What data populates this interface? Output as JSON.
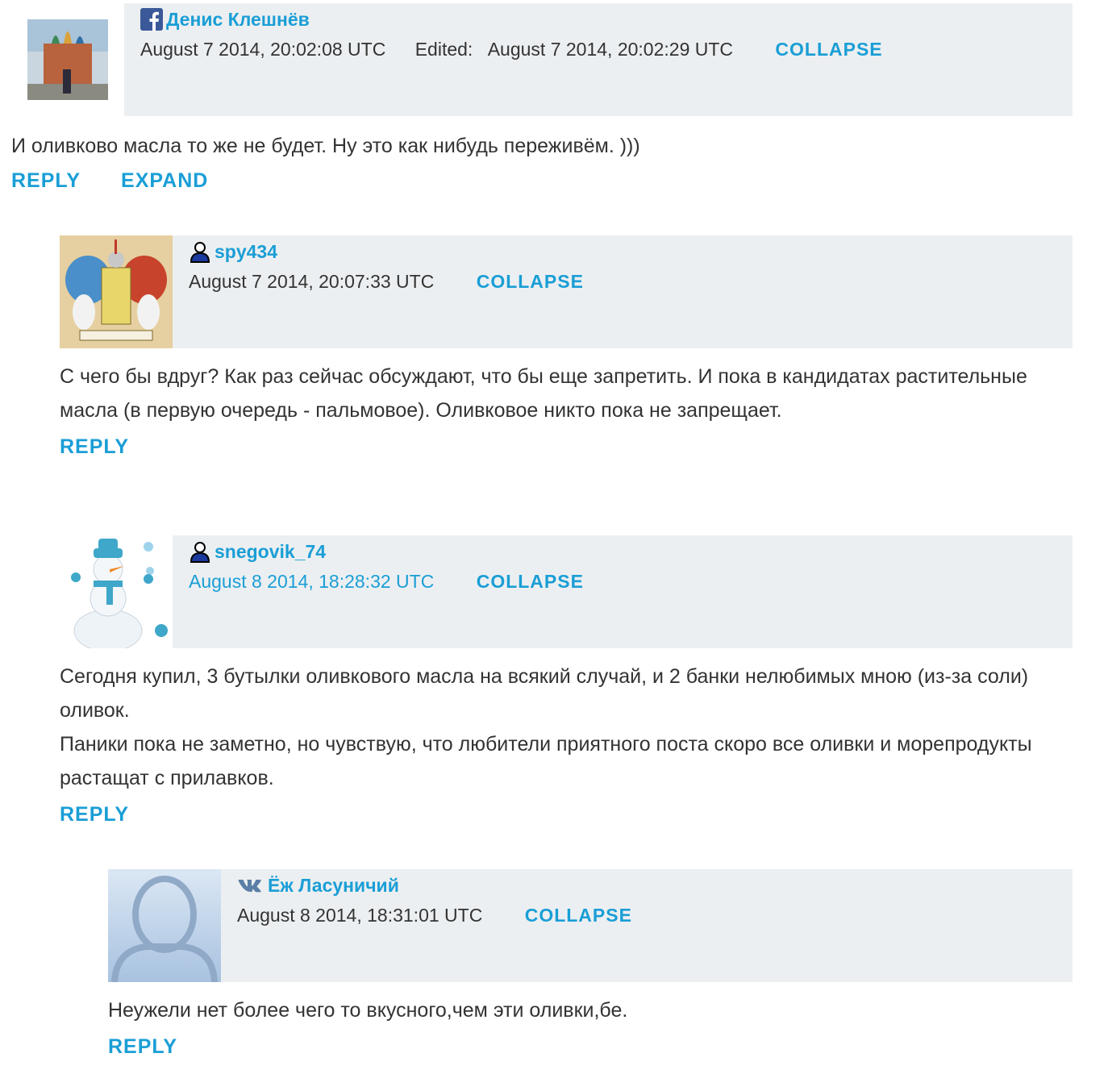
{
  "comments": [
    {
      "author": "Денис Клешнёв",
      "network_icon": "facebook-icon",
      "date": "August 7 2014, 20:02:08 UTC",
      "edited_label": "Edited:",
      "edited_date": "August 7 2014, 20:02:29 UTC",
      "collapse_label": "COLLAPSE",
      "text": "И оливково масла то же не будет. Ну это как нибудь переживём. )))",
      "reply_label": "REPLY",
      "expand_label": "EXPAND"
    },
    {
      "author": "spy434",
      "network_icon": "user-icon",
      "date": "August 7 2014, 20:07:33 UTC",
      "collapse_label": "COLLAPSE",
      "text": "С чего бы вдруг? Как раз сейчас обсуждают, что бы еще запретить. И пока в кандидатах растительные масла (в первую очередь - пальмовое). Оливковое никто пока не запрещает.",
      "reply_label": "REPLY"
    },
    {
      "author": "snegovik_74",
      "network_icon": "user-icon",
      "date": "August 8 2014, 18:28:32 UTC",
      "collapse_label": "COLLAPSE",
      "text_line1": "Сегодня купил, 3 бутылки оливкового масла на всякий случай, и 2 банки нелюбимых мною (из-за соли) оливок.",
      "text_line2": "Паники пока не заметно, но чувствую, что любители приятного поста скоро все оливки и морепродукты растащат с прилавков.",
      "reply_label": "REPLY"
    },
    {
      "author": "Ёж Ласуничий",
      "network_icon": "vk-icon",
      "date": "August 8 2014, 18:31:01 UTC",
      "collapse_label": "COLLAPSE",
      "text": "Неужели нет более чего то вкусного,чем эти оливки,бе.",
      "reply_label": "REPLY"
    }
  ],
  "colors": {
    "accent": "#1a9ed6",
    "header_bg": "#eceff1",
    "text": "#333333"
  }
}
